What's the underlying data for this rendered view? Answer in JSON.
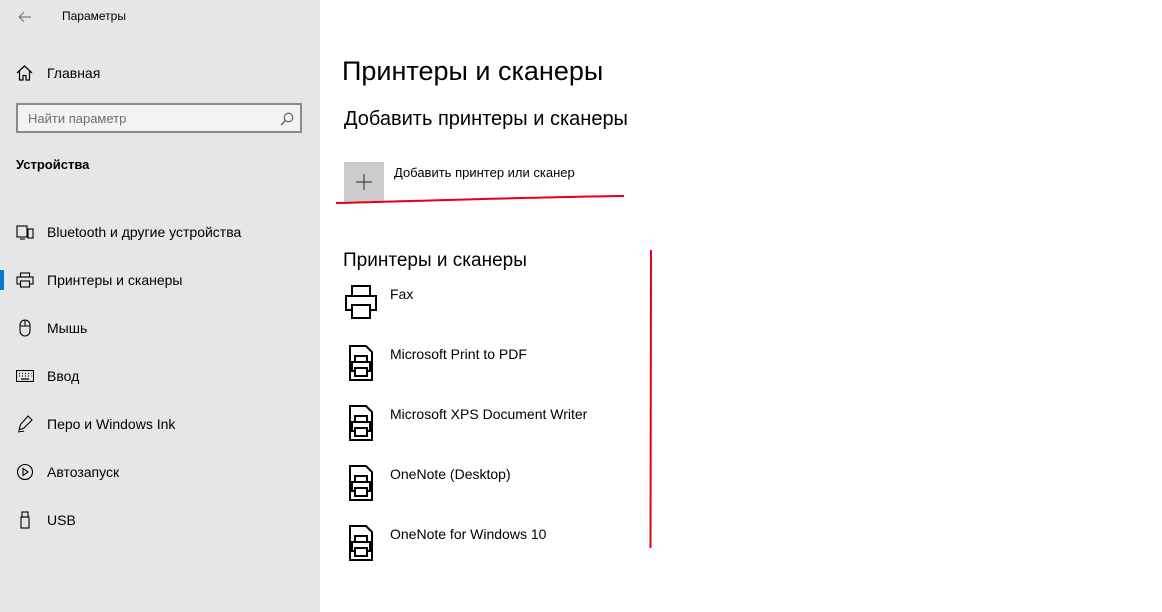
{
  "window": {
    "title": "Параметры"
  },
  "sidebar": {
    "home_label": "Главная",
    "search_placeholder": "Найти параметр",
    "section_title": "Устройства",
    "items": [
      {
        "label": "Bluetooth и другие устройства",
        "icon": "bluetooth-devices-icon"
      },
      {
        "label": "Принтеры и сканеры",
        "icon": "printer-icon",
        "active": true
      },
      {
        "label": "Мышь",
        "icon": "mouse-icon"
      },
      {
        "label": "Ввод",
        "icon": "keyboard-icon"
      },
      {
        "label": "Перо и Windows Ink",
        "icon": "pen-icon"
      },
      {
        "label": "Автозапуск",
        "icon": "autoplay-icon"
      },
      {
        "label": "USB",
        "icon": "usb-icon"
      }
    ]
  },
  "main": {
    "title": "Принтеры и сканеры",
    "add_section_title": "Добавить принтеры и сканеры",
    "add_button_label": "Добавить принтер или сканер",
    "list_title": "Принтеры и сканеры",
    "printers": [
      {
        "name": "Fax",
        "icon": "fax-printer-icon"
      },
      {
        "name": "Microsoft Print to PDF",
        "icon": "document-printer-icon"
      },
      {
        "name": "Microsoft XPS Document Writer",
        "icon": "document-printer-icon"
      },
      {
        "name": "OneNote (Desktop)",
        "icon": "document-printer-icon"
      },
      {
        "name": "OneNote for Windows 10",
        "icon": "document-printer-icon"
      }
    ]
  },
  "colors": {
    "sidebar_bg": "#e6e6e6",
    "accent": "#0078d7",
    "annotation_red": "#e0001b",
    "add_tile_bg": "#cccccc"
  }
}
